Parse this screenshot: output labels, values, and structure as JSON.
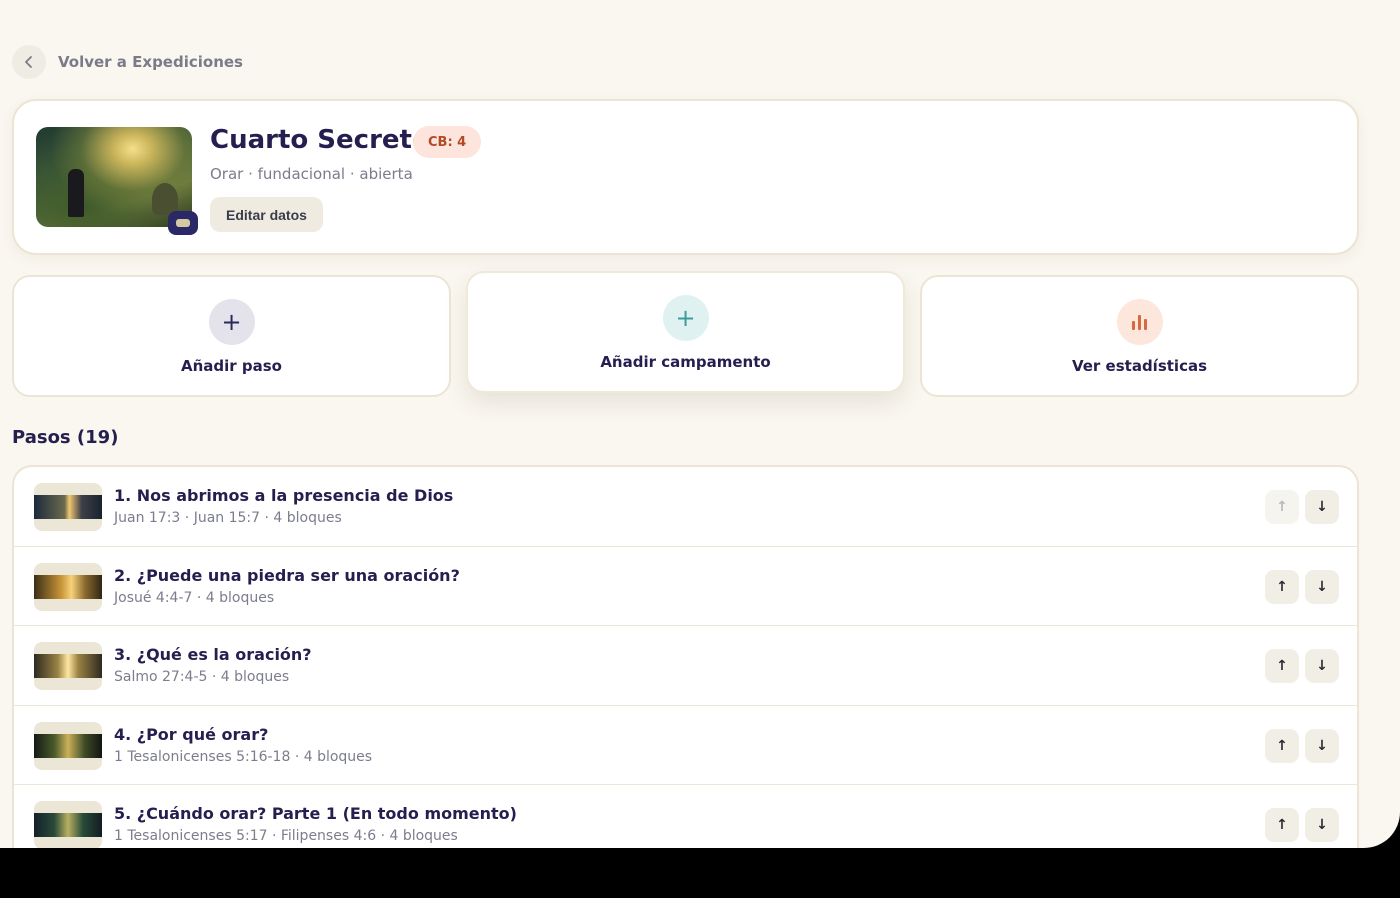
{
  "back": {
    "label": "Volver a Expediciones",
    "icon": "chevron-left-icon"
  },
  "expedition": {
    "title": "Cuarto Secreto",
    "badge": "CB: 4",
    "subtitle": "Orar · fundacional · abierta",
    "edit_label": "Editar datos"
  },
  "actions": [
    {
      "label": "Añadir paso",
      "icon": "plus-icon",
      "glyph": "+"
    },
    {
      "label": "Añadir campamento",
      "icon": "plus-icon",
      "glyph": "+"
    },
    {
      "label": "Ver estadísticas",
      "icon": "bar-chart-icon"
    }
  ],
  "steps": {
    "title": "Pasos (19)",
    "up_glyph": "↑",
    "down_glyph": "↓",
    "items": [
      {
        "title": "1. Nos abrimos a la presencia de Dios",
        "meta": "Juan 17:3 · Juan 15:7 · 4 bloques"
      },
      {
        "title": "2. ¿Puede una piedra ser una oración?",
        "meta": "Josué 4:4-7 · 4 bloques"
      },
      {
        "title": "3. ¿Qué es la oración?",
        "meta": "Salmo 27:4-5 · 4 bloques"
      },
      {
        "title": "4. ¿Por qué orar?",
        "meta": "1 Tesalonicenses 5:16-18 · 4 bloques"
      },
      {
        "title": "5. ¿Cuándo orar? Parte 1 (En todo momento)",
        "meta": "1 Tesalonicenses 5:17 · Filipenses 4:6 · 4 bloques"
      }
    ]
  },
  "colors": {
    "accent_navy": "#241f4f",
    "badge_bg": "#fde4dc",
    "badge_text": "#b24a26",
    "teal": "#3d9b9a",
    "orange": "#d56a3e"
  }
}
